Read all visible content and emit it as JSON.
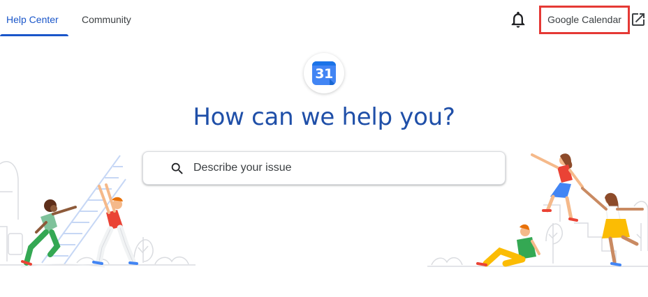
{
  "tabs": [
    {
      "label": "Help Center",
      "active": true
    },
    {
      "label": "Community",
      "active": false
    }
  ],
  "header": {
    "product_link": "Google Calendar",
    "notifications_icon": "bell-icon",
    "external_icon": "open-in-new-icon"
  },
  "logo": {
    "number": "31"
  },
  "main": {
    "headline": "How can we help you?",
    "search_placeholder": "Describe your issue"
  },
  "colors": {
    "accent": "#1a56c9",
    "headline": "#1f4fa8",
    "highlight_border": "#e53935"
  }
}
